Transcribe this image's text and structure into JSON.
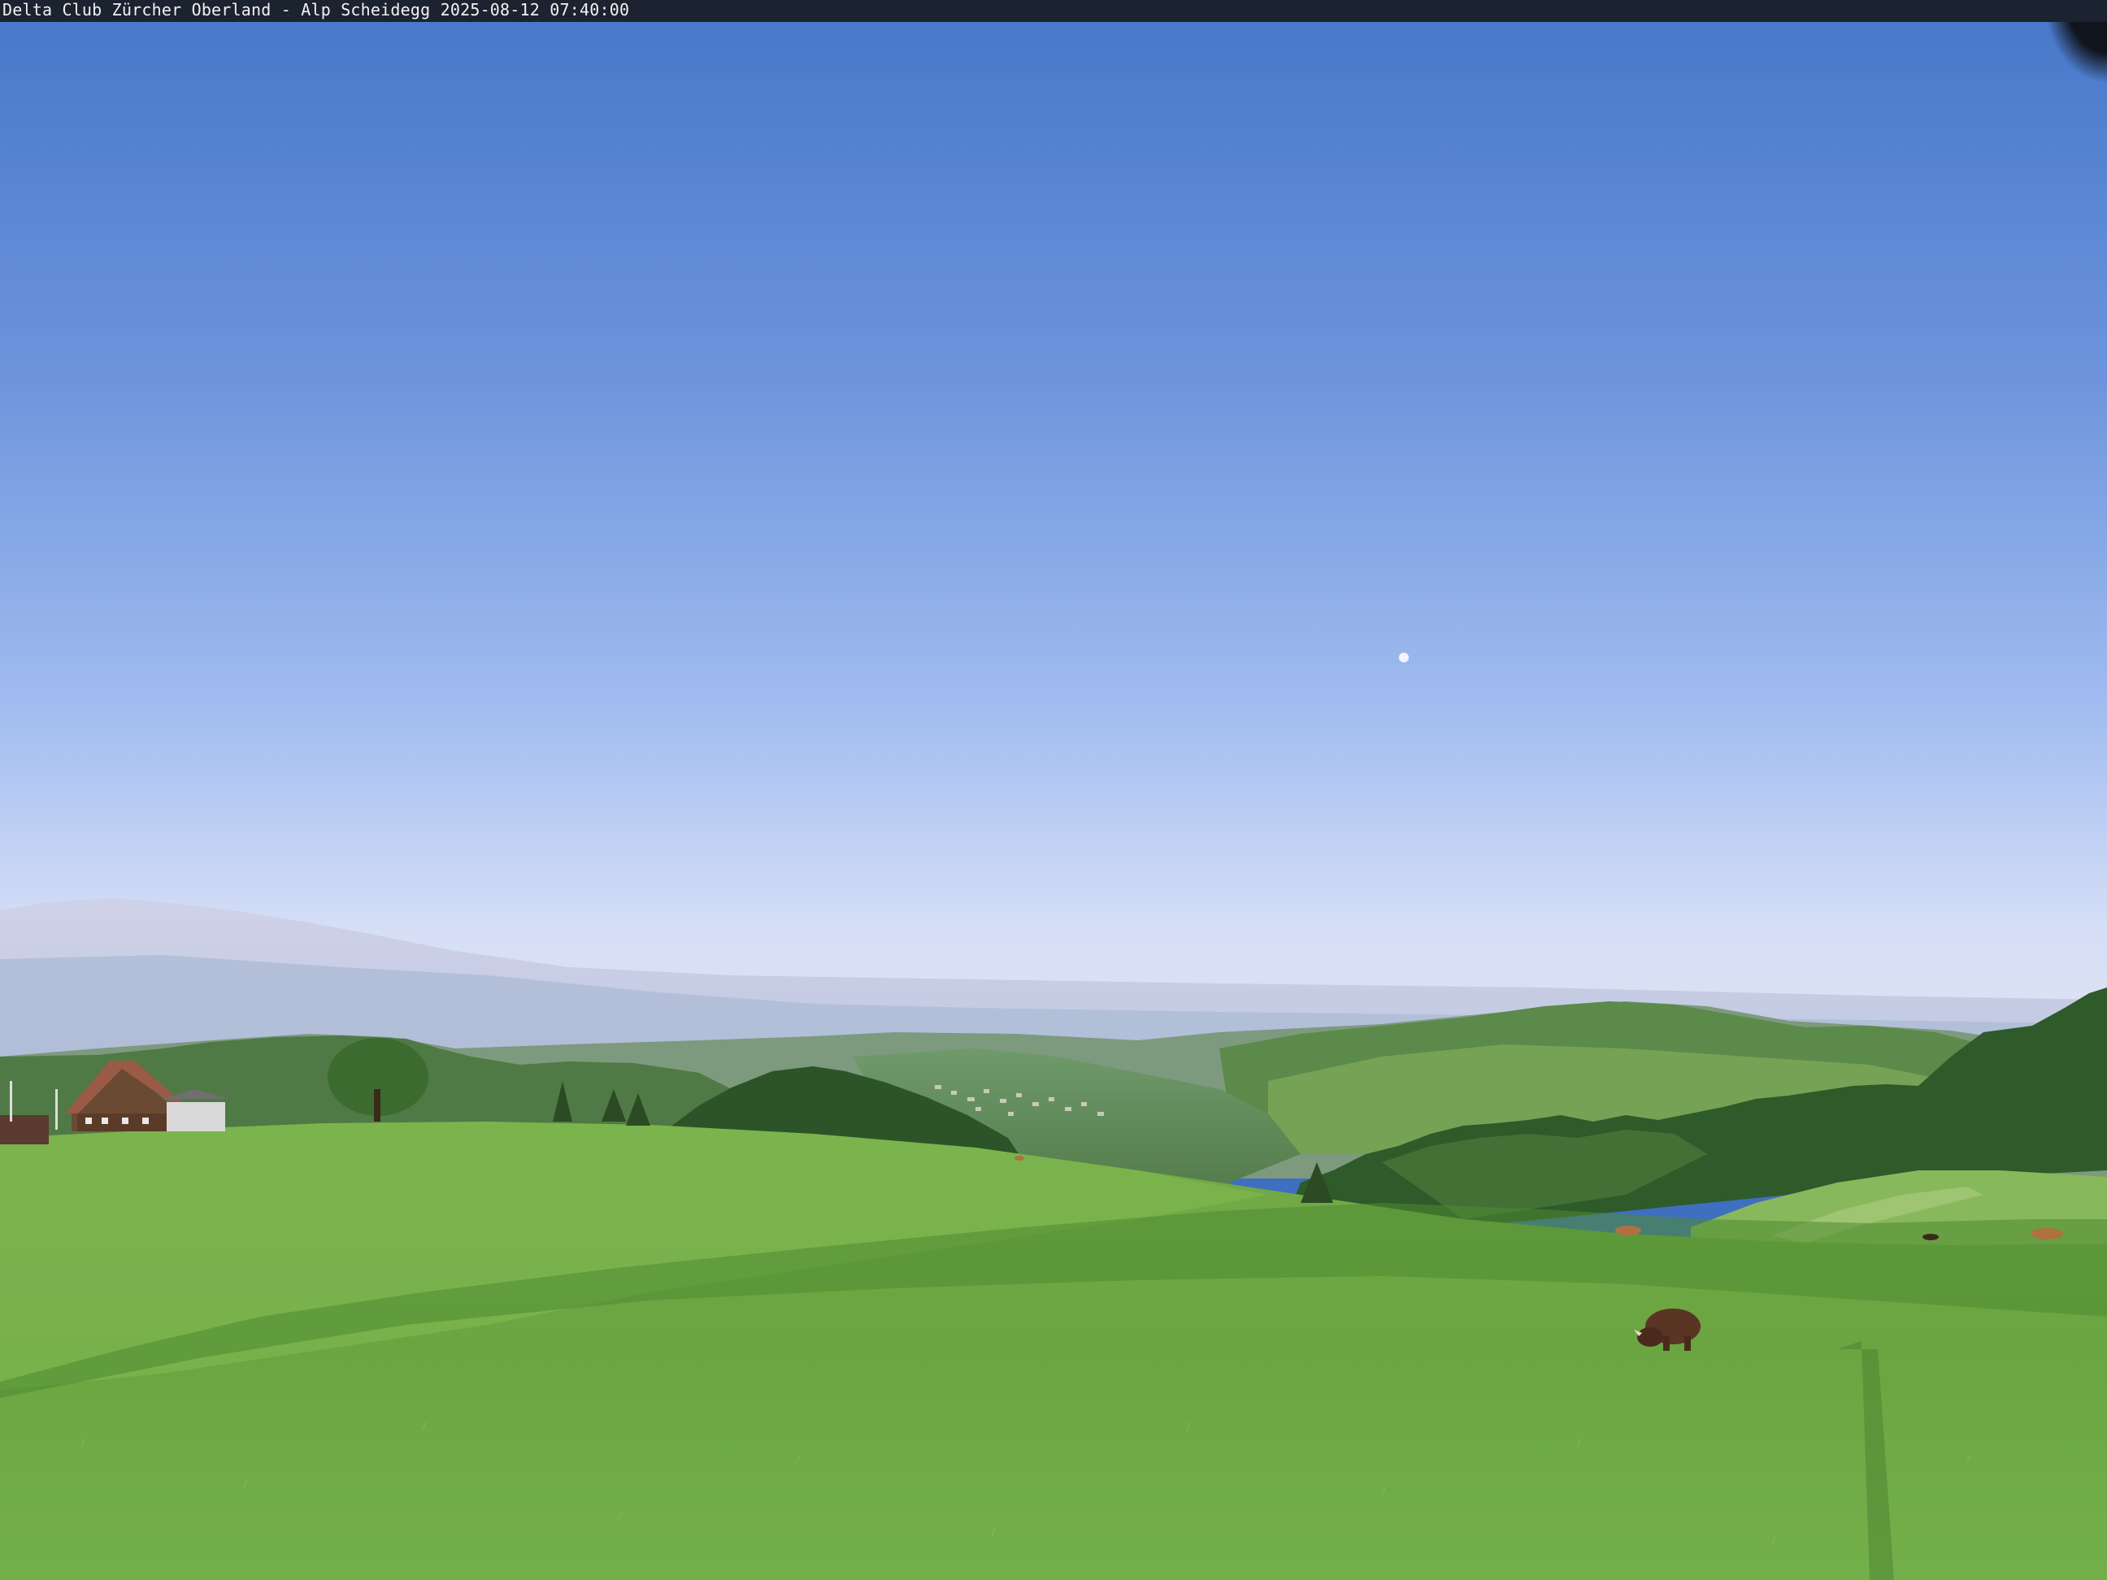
{
  "webcam": {
    "caption": "Delta Club Zürcher Oberland - Alp Scheidegg 2025-08-12 07:40:00"
  },
  "colors": {
    "sky_top": "#4a78c8",
    "sky_mid": "#8aa9e6",
    "sky_horizon": "#d8dff4",
    "haze": "#c9cde6",
    "grass_light": "#7fb552",
    "grass_dark": "#5e9a3a",
    "forest": "#2f5a2a"
  }
}
